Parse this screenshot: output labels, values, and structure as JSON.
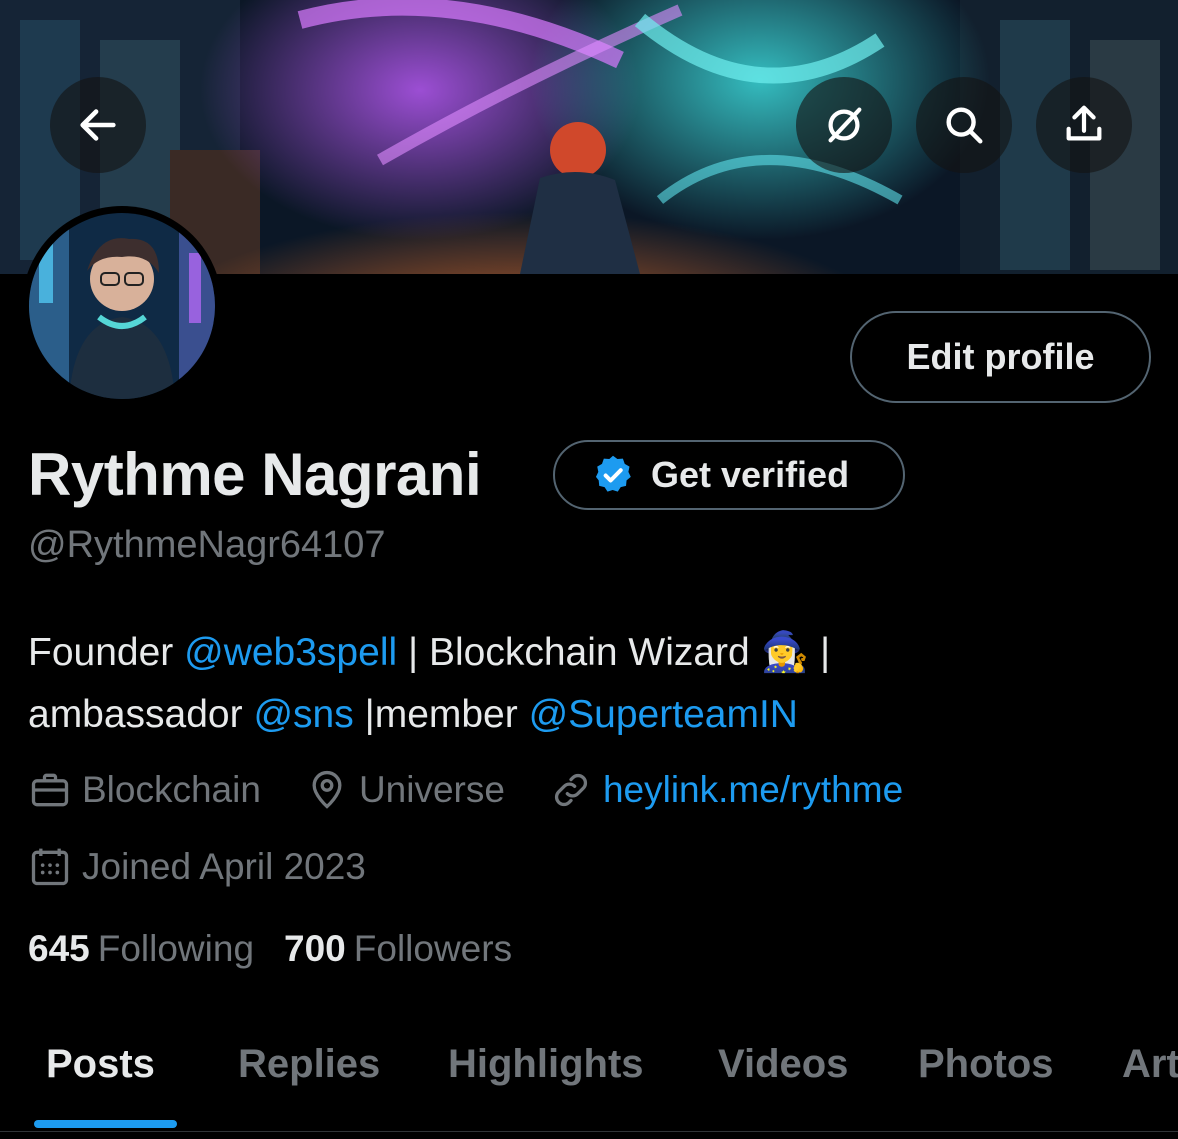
{
  "profile": {
    "name": "Rythme Nagrani",
    "handle": "@RythmeNagr64107",
    "get_verified_label": "Get verified",
    "edit_profile_label": "Edit profile",
    "bio": {
      "part1": "Founder ",
      "mention1": "@web3spell",
      "part2": " | Blockchain Wizard 🧙‍♀️ |",
      "part3": "ambassador ",
      "mention2": "@sns",
      "part4": " |member ",
      "mention3": "@SuperteamIN"
    },
    "category": "Blockchain",
    "location": "Universe",
    "website": "heylink.me/rythme",
    "joined": "Joined April 2023",
    "following_count": "645",
    "following_label": "Following",
    "followers_count": "700",
    "followers_label": "Followers"
  },
  "tabs": [
    {
      "label": "Posts",
      "active": true
    },
    {
      "label": "Replies"
    },
    {
      "label": "Highlights"
    },
    {
      "label": "Videos"
    },
    {
      "label": "Photos"
    },
    {
      "label": "Art"
    }
  ],
  "icons": {
    "back": "arrow-left-icon",
    "grok": "grok-icon",
    "search": "search-icon",
    "share": "share-icon",
    "verified": "verified-badge-icon",
    "category": "briefcase-icon",
    "location": "location-pin-icon",
    "website": "link-icon",
    "joined": "calendar-icon"
  },
  "colors": {
    "background": "#000000",
    "text_primary": "#e7e9ea",
    "text_secondary": "#71767b",
    "accent": "#1d9bf0",
    "border": "#536471"
  }
}
